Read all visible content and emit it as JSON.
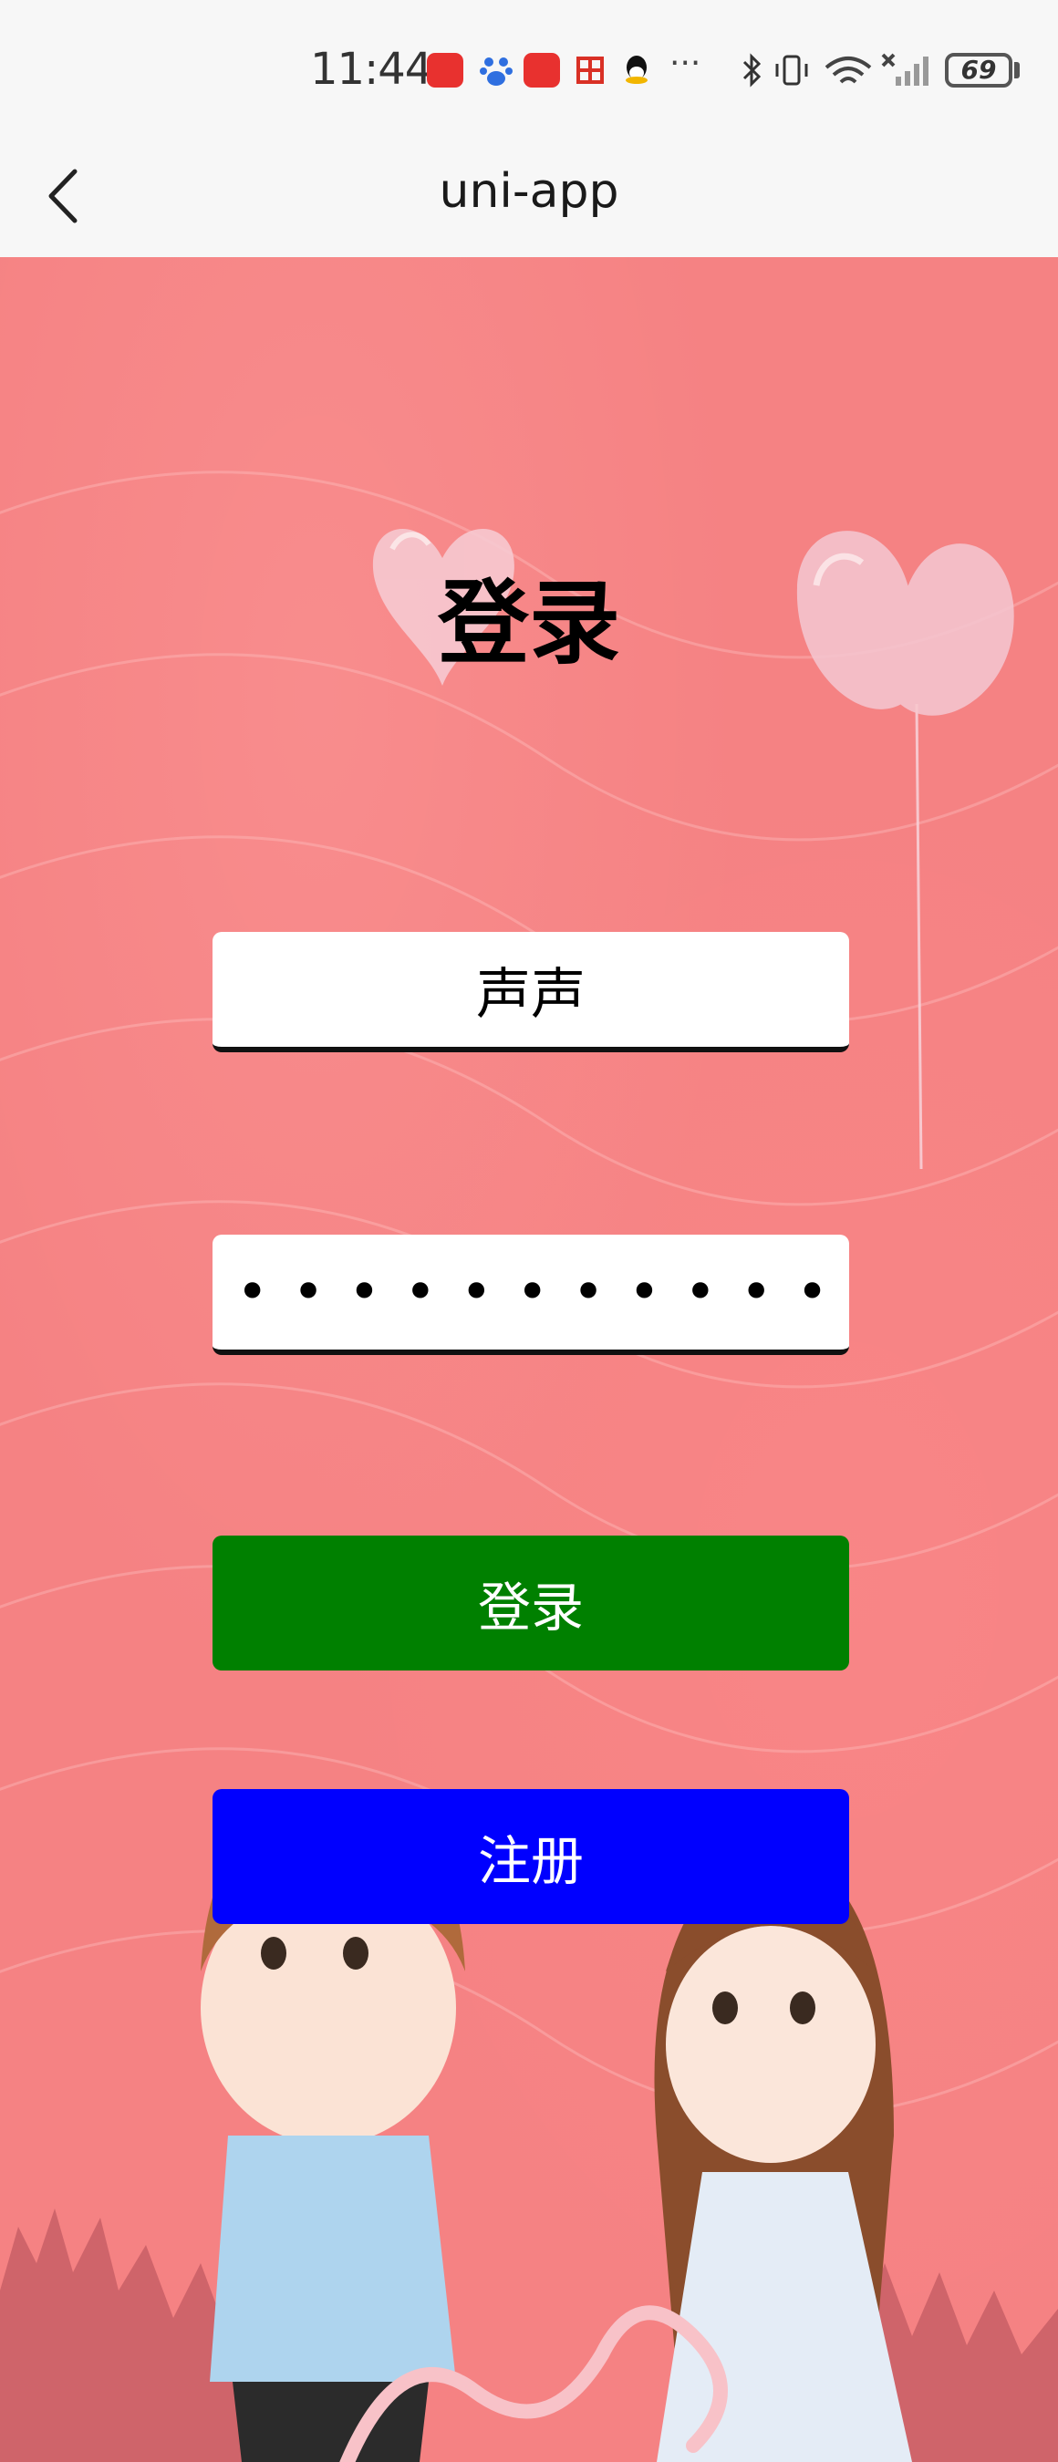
{
  "status_bar": {
    "time": "11:44",
    "battery": "69",
    "more": "···",
    "icons": [
      "huawei-store-icon",
      "baidu-icon",
      "huawei-store-icon",
      "mail-icon",
      "qq-icon",
      "more-icon",
      "bluetooth-icon",
      "vibrate-icon",
      "wifi-icon",
      "signal-icon",
      "battery-icon"
    ]
  },
  "nav": {
    "title": "uni-app",
    "back_icon": "chevron-left-icon"
  },
  "page": {
    "title": "登录",
    "username_value": "声声",
    "password_mask": "•••••••••••",
    "login_label": "登录",
    "register_label": "注册"
  },
  "colors": {
    "background": "#f58283",
    "login_button": "#008000",
    "register_button": "#0000ff"
  }
}
